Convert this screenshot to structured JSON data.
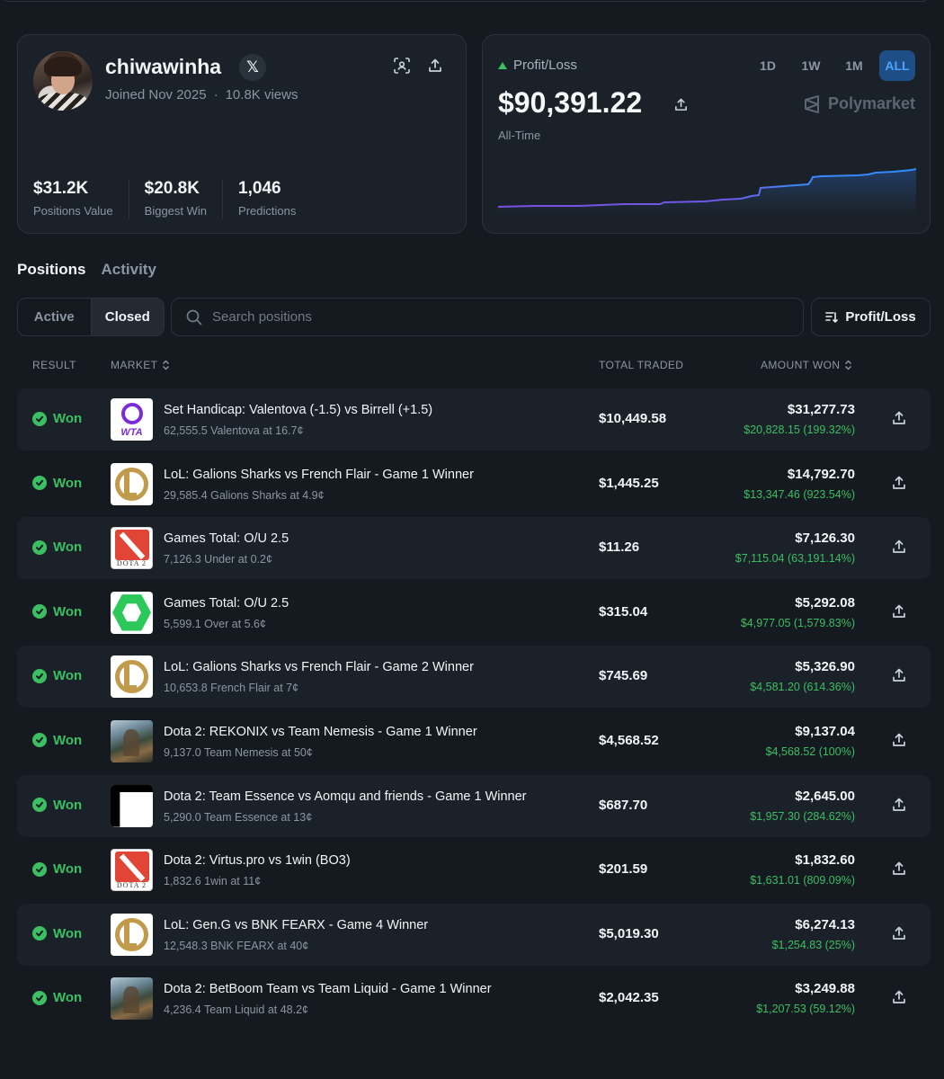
{
  "profile": {
    "username": "chiwawinha",
    "x_badge": "𝕏",
    "joined": "Joined Nov 2025",
    "separator": "·",
    "views": "10.8K views",
    "stats": [
      {
        "value": "$31.2K",
        "label": "Positions Value"
      },
      {
        "value": "$20.8K",
        "label": "Biggest Win"
      },
      {
        "value": "1,046",
        "label": "Predictions"
      }
    ]
  },
  "pnl": {
    "label": "Profit/Loss",
    "value": "$90,391.22",
    "period": "All-Time",
    "brand": "Polymarket",
    "ranges": [
      "1D",
      "1W",
      "1M",
      "ALL"
    ],
    "active_range": "ALL",
    "colors": {
      "line_start": "#7b4fe0",
      "line_end": "#2f8cff",
      "up": "#3bbf62"
    }
  },
  "tabs": {
    "positions": "Positions",
    "activity": "Activity"
  },
  "filters": {
    "active": "Active",
    "closed": "Closed",
    "search_placeholder": "Search positions",
    "sort": "Profit/Loss"
  },
  "table": {
    "headers": {
      "result": "RESULT",
      "market": "MARKET",
      "total_traded": "TOTAL TRADED",
      "amount_won": "AMOUNT WON"
    },
    "rows": [
      {
        "result": "Won",
        "logo": "wta",
        "logo_text": "WTA",
        "title": "Set Handicap: Valentova (-1.5) vs Birrell (+1.5)",
        "sub": "62,555.5 Valentova at 16.7¢",
        "traded": "$10,449.58",
        "amount": "$31,277.73",
        "gain": "$20,828.15 (199.32%)"
      },
      {
        "result": "Won",
        "logo": "lol",
        "logo_text": "",
        "title": "LoL: Galions Sharks vs French Flair - Game 1 Winner",
        "sub": "29,585.4 Galions Sharks at 4.9¢",
        "traded": "$1,445.25",
        "amount": "$14,792.70",
        "gain": "$13,347.46 (923.54%)"
      },
      {
        "result": "Won",
        "logo": "dota",
        "logo_text": "DOTA 2",
        "title": "Games Total: O/U 2.5",
        "sub": "7,126.3 Under at 0.2¢",
        "traded": "$11.26",
        "amount": "$7,126.30",
        "gain": "$7,115.04 (63,191.14%)"
      },
      {
        "result": "Won",
        "logo": "green",
        "logo_text": "",
        "title": "Games Total: O/U 2.5",
        "sub": "5,599.1 Over at 5.6¢",
        "traded": "$315.04",
        "amount": "$5,292.08",
        "gain": "$4,977.05 (1,579.83%)"
      },
      {
        "result": "Won",
        "logo": "lol",
        "logo_text": "",
        "title": "LoL: Galions Sharks vs French Flair - Game 2 Winner",
        "sub": "10,653.8 French Flair at 7¢",
        "traded": "$745.69",
        "amount": "$5,326.90",
        "gain": "$4,581.20 (614.36%)"
      },
      {
        "result": "Won",
        "logo": "art",
        "logo_text": "",
        "title": "Dota 2: REKONIX vs Team Nemesis - Game 1 Winner",
        "sub": "9,137.0 Team Nemesis at 50¢",
        "traded": "$4,568.52",
        "amount": "$9,137.04",
        "gain": "$4,568.52 (100%)"
      },
      {
        "result": "Won",
        "logo": "essence",
        "logo_text": "",
        "title": "Dota 2: Team Essence vs Aomqu and friends - Game 1 Winner",
        "sub": "5,290.0 Team Essence at 13¢",
        "traded": "$687.70",
        "amount": "$2,645.00",
        "gain": "$1,957.30 (284.62%)"
      },
      {
        "result": "Won",
        "logo": "dota",
        "logo_text": "DOTA 2",
        "title": "Dota 2: Virtus.pro vs 1win (BO3)",
        "sub": "1,832.6 1win at 11¢",
        "traded": "$201.59",
        "amount": "$1,832.60",
        "gain": "$1,631.01 (809.09%)"
      },
      {
        "result": "Won",
        "logo": "lol",
        "logo_text": "",
        "title": "LoL: Gen.G vs BNK FEARX - Game 4 Winner",
        "sub": "12,548.3 BNK FEARX at 40¢",
        "traded": "$5,019.30",
        "amount": "$6,274.13",
        "gain": "$1,254.83 (25%)"
      },
      {
        "result": "Won",
        "logo": "art",
        "logo_text": "",
        "title": "Dota 2: BetBoom Team vs Team Liquid - Game 1 Winner",
        "sub": "4,236.4 Team Liquid at 48.2¢",
        "traded": "$2,042.35",
        "amount": "$3,249.88",
        "gain": "$1,207.53 (59.12%)"
      }
    ]
  }
}
